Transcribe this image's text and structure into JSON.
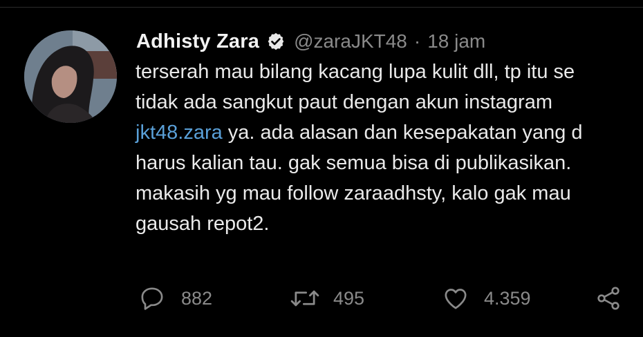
{
  "tweet": {
    "author_name": "Adhisty Zara",
    "handle": "@zaraJKT48",
    "separator": "·",
    "time": "18 jam",
    "lines": [
      "terserah mau bilang kacang lupa kulit dll, tp itu se",
      "tidak ada sangkut paut dengan akun instagram",
      "jkt48.zara",
      " ya. ada alasan dan kesepakatan yang d",
      "harus kalian tau. gak semua bisa di publikasikan.",
      "makasih yg mau follow zaraadhsty, kalo gak mau",
      "gausah repot2."
    ]
  },
  "actions": {
    "reply_count": "882",
    "retweet_count": "495",
    "like_count": "4.359"
  },
  "colors": {
    "background": "#000000",
    "link": "#5aa0d8",
    "muted": "#8a8a8a"
  },
  "icons": {
    "verified": "verified-badge-icon",
    "reply": "reply-icon",
    "retweet": "retweet-icon",
    "like": "heart-icon",
    "share": "share-icon"
  }
}
